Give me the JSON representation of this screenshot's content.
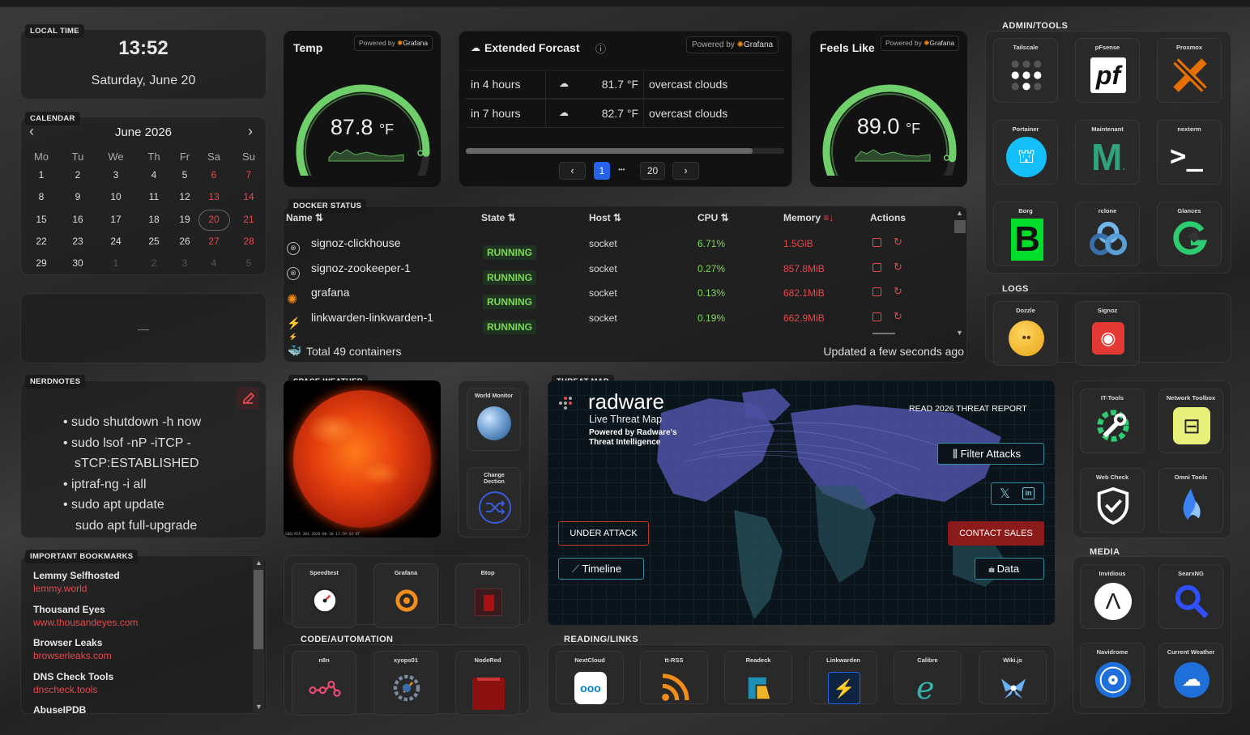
{
  "local_time": {
    "section": "LOCAL TIME",
    "time": "13:52",
    "date": "Saturday, June 20"
  },
  "calendar": {
    "section": "CALENDAR",
    "month": "June 2026",
    "prev": "‹",
    "next": "›",
    "weekdays": [
      "Mo",
      "Tu",
      "We",
      "Th",
      "Fr",
      "Sa",
      "Su"
    ],
    "weeks": [
      [
        "1",
        "2",
        "3",
        "4",
        "5",
        "6",
        "7"
      ],
      [
        "8",
        "9",
        "10",
        "11",
        "12",
        "13",
        "14"
      ],
      [
        "15",
        "16",
        "17",
        "18",
        "19",
        "20",
        "21"
      ],
      [
        "22",
        "23",
        "24",
        "25",
        "26",
        "27",
        "28"
      ],
      [
        "29",
        "30",
        "1",
        "2",
        "3",
        "4",
        "5"
      ]
    ],
    "today": "20"
  },
  "blank_widget": {
    "text": "—"
  },
  "nerdnotes": {
    "section": "NERDNOTES",
    "items": [
      "sudo shutdown -h now",
      "sudo lsof -nP -iTCP -sTCP:ESTABLISHED",
      "iptraf-ng -i all",
      "sudo apt update"
    ],
    "extra": "sudo apt full-upgrade"
  },
  "bookmarks": {
    "section": "IMPORTANT BOOKMARKS",
    "items": [
      {
        "name": "Lemmy Selfhosted",
        "url": "lemmy.world"
      },
      {
        "name": "Thousand Eyes",
        "url": "www.thousandeyes.com"
      },
      {
        "name": "Browser Leaks",
        "url": "browserleaks.com"
      },
      {
        "name": "DNS Check Tools",
        "url": "dnscheck.tools"
      },
      {
        "name": "AbuseIPDB",
        "url": ""
      }
    ]
  },
  "temp": {
    "title": "Temp",
    "value": "87.8",
    "unit": "°F",
    "fraction": 0.88,
    "powered": "Powered by",
    "brand": "Grafana"
  },
  "feels": {
    "title": "Feels Like",
    "value": "89.0",
    "unit": "°F",
    "fraction": 0.9,
    "powered": "Powered by",
    "brand": "Grafana"
  },
  "forecast": {
    "title": "Extended Forcast",
    "powered": "Powered by",
    "brand": "Grafana",
    "info": "ⓘ",
    "rows": [
      {
        "when": "in 4 hours",
        "temp": "81.7 °F",
        "desc": "overcast clouds"
      },
      {
        "when": "in 7 hours",
        "temp": "82.7 °F",
        "desc": "overcast clouds"
      }
    ],
    "pager": {
      "prev": "‹",
      "current": "1",
      "dots": "•••",
      "last": "20",
      "next": "›"
    }
  },
  "docker": {
    "section": "DOCKER STATUS",
    "headers": {
      "name": "Name ⇅",
      "state": "State ⇅",
      "host": "Host ⇅",
      "cpu": "CPU ⇅",
      "memory": "Memory",
      "actions": "Actions"
    },
    "rows": [
      {
        "name": "signoz-clickhouse",
        "state": "RUNNING",
        "host": "socket",
        "cpu": "6.71%",
        "mem": "1.5GiB"
      },
      {
        "name": "signoz-zookeeper-1",
        "state": "RUNNING",
        "host": "socket",
        "cpu": "0.27%",
        "mem": "857.8MiB"
      },
      {
        "name": "grafana",
        "state": "RUNNING",
        "host": "socket",
        "cpu": "0.13%",
        "mem": "682.1MiB"
      },
      {
        "name": "linkwarden-linkwarden-1",
        "state": "RUNNING",
        "host": "socket",
        "cpu": "0.19%",
        "mem": "662.9MiB"
      }
    ],
    "total": "Total 49 containers",
    "updated": "Updated a few seconds ago"
  },
  "space_weather": {
    "section": "SPACE WEATHER",
    "caption": "SDO/AIA 304 2026-06-20 17:59:54 UT"
  },
  "world_monitor": {
    "label": "World Monitor"
  },
  "change_detection": {
    "label": "Change Dection"
  },
  "apps_mid": [
    {
      "label": "Speedtest"
    },
    {
      "label": "Grafana"
    },
    {
      "label": "Btop"
    }
  ],
  "code_automation": {
    "section": "CODE/AUTOMATION",
    "items": [
      {
        "label": "n8n"
      },
      {
        "label": "xyops01"
      },
      {
        "label": "NodeRed"
      }
    ]
  },
  "threat_map": {
    "section": "THREAT MAP",
    "brand": "radware",
    "subtitle": "Live Threat Map",
    "powered1": "Powered by Radware's",
    "powered2": "Threat Intelligence",
    "report": "READ 2026 THREAT REPORT",
    "filter": "Filter Attacks",
    "under_attack": "UNDER ATTACK",
    "contact": "CONTACT SALES",
    "timeline": "Timeline",
    "data": "Data"
  },
  "reading": {
    "section": "READING/LINKS",
    "items": [
      {
        "label": "NextCloud"
      },
      {
        "label": "tt-RSS"
      },
      {
        "label": "Readeck"
      },
      {
        "label": "Linkwarden"
      },
      {
        "label": "Calibre"
      },
      {
        "label": "Wiki.js"
      }
    ]
  },
  "admin": {
    "section": "ADMIN/TOOLS",
    "items": [
      {
        "label": "Tailscale"
      },
      {
        "label": "pFsense"
      },
      {
        "label": "Proxmox"
      },
      {
        "label": "Portainer"
      },
      {
        "label": "Maintenant"
      },
      {
        "label": "nexterm"
      },
      {
        "label": "Borg"
      },
      {
        "label": "rclone"
      },
      {
        "label": "Glances"
      }
    ]
  },
  "logs": {
    "section": "LOGS",
    "items": [
      {
        "label": "Dozzle"
      },
      {
        "label": "Signoz"
      }
    ]
  },
  "tools": {
    "items": [
      {
        "label": "IT-Tools"
      },
      {
        "label": "Network Toolbox"
      },
      {
        "label": "Web Check"
      },
      {
        "label": "Omni Tools"
      }
    ]
  },
  "media": {
    "section": "MEDIA",
    "items": [
      {
        "label": "Invidious"
      },
      {
        "label": "SearxNG"
      },
      {
        "label": "Navidrome"
      },
      {
        "label": "Current Weather"
      }
    ]
  },
  "colors": {
    "accent": "#e5484d",
    "gauge": "#6fcf6a",
    "running": "#7ed957",
    "cpu": "#7ed957",
    "mem": "#e5484d",
    "teal": "#2f8f9d"
  }
}
